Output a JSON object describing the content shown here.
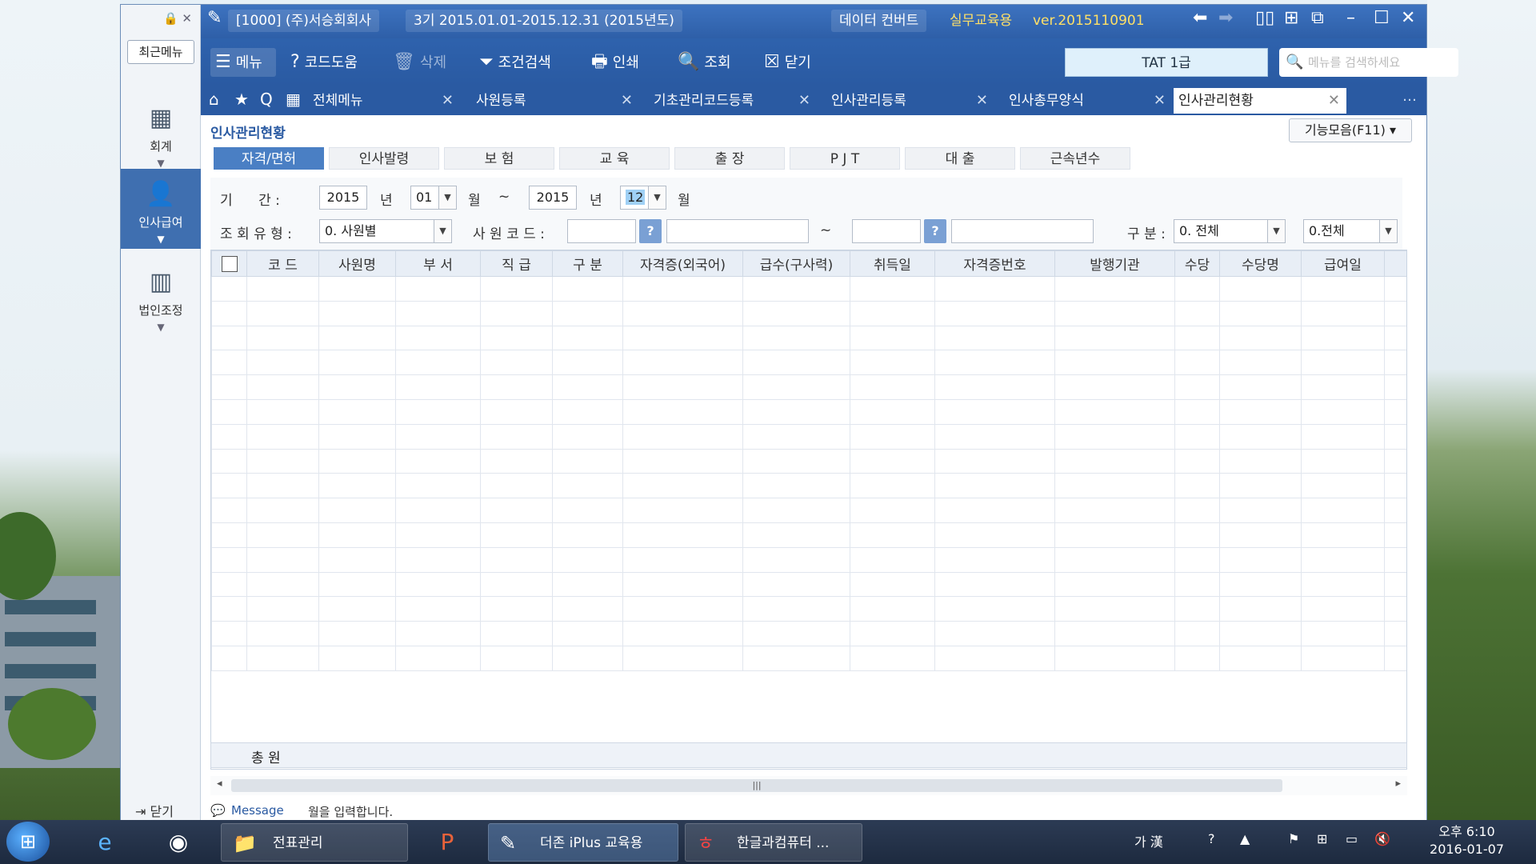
{
  "window": {
    "company": "[1000] (주)서승회회사",
    "period": "3기 2015.01.01-2015.12.31 (2015년도)",
    "data_convert": "데이터 컨버트",
    "edu_label": "실무교육용",
    "version": "ver.2015110901"
  },
  "sidebar": {
    "recent_label": "최근메뉴",
    "items": [
      {
        "label": "회계"
      },
      {
        "label": "인사급여"
      },
      {
        "label": "법인조정"
      }
    ],
    "close_label": "닫기"
  },
  "toolbar": {
    "menu_label": "메뉴",
    "code_help_label": "코드도움",
    "delete_label": "삭제",
    "filter_label": "조건검색",
    "print_label": "인쇄",
    "view_label": "조회",
    "close_label": "닫기",
    "tat_label": "TAT 1급",
    "search_placeholder": "메뉴를 검색하세요"
  },
  "tabs": [
    {
      "label": "전체메뉴"
    },
    {
      "label": "사원등록"
    },
    {
      "label": "기초관리코드등록"
    },
    {
      "label": "인사관리등록"
    },
    {
      "label": "인사총무양식"
    },
    {
      "label": "인사관리현황"
    }
  ],
  "page": {
    "title": "인사관리현황",
    "function_button": "기능모음(F11)",
    "subtabs": [
      "자격/면허",
      "인사발령",
      "보  험",
      "교  육",
      "출  장",
      "P J T",
      "대  출",
      "근속년수"
    ]
  },
  "filters": {
    "period_label": "기      간 :",
    "year_from": "2015",
    "year_unit": "년",
    "month_from": "01",
    "month_unit": "월",
    "tilde": "~",
    "year_to": "2015",
    "month_to": "12",
    "query_type_label": "조 회 유 형 :",
    "query_type_value": "0. 사원별",
    "employee_code_label": "사 원 코 드 :",
    "division_label": "구 분 :",
    "division_value": "0. 전체",
    "extra_value": "0.전체"
  },
  "table": {
    "headers": [
      "코 드",
      "사원명",
      "부 서",
      "직 급",
      "구 분",
      "자격증(외국어)",
      "급수(구사력)",
      "취득일",
      "자격증번호",
      "발행기관",
      "수당",
      "수당명",
      "급여일"
    ],
    "total_label": "총  원"
  },
  "message": {
    "label": "Message",
    "text": "월을 입력합니다."
  },
  "taskbar": {
    "tasks": [
      "전표관리",
      "더존 iPlus 교육용",
      "한글과컴퓨터 ..."
    ],
    "clock_time": "오후 6:10",
    "clock_date": "2016-01-07",
    "ime_label": "가 漢"
  }
}
